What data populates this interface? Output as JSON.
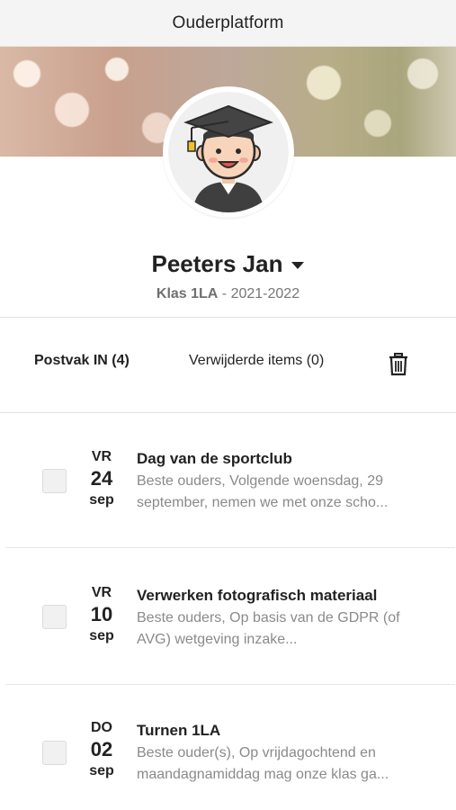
{
  "app": {
    "title": "Ouderplatform"
  },
  "profile": {
    "name": "Peeters Jan",
    "class_label": "Klas 1LA",
    "class_sep": " - ",
    "year": "2021-2022"
  },
  "tabs": {
    "inbox": "Postvak IN (4)",
    "deleted": "Verwijderde items (0)"
  },
  "messages": [
    {
      "day": "VR",
      "num": "24",
      "month": "sep",
      "title": "Dag van de sportclub",
      "preview": "Beste ouders,   Volgende woensdag, 29 september, nemen we met onze scho..."
    },
    {
      "day": "VR",
      "num": "10",
      "month": "sep",
      "title": "Verwerken fotografisch materiaal",
      "preview": "Beste ouders, Op basis van de GDPR (of AVG) wetgeving inzake..."
    },
    {
      "day": "DO",
      "num": "02",
      "month": "sep",
      "title": "Turnen 1LA",
      "preview": "Beste ouder(s), Op vrijdagochtend en maandagnamiddag mag onze klas ga..."
    }
  ],
  "icons": {
    "avatar": "graduate-avatar-icon",
    "dropdown": "caret-down-icon",
    "trash": "trash-icon"
  },
  "colors": {
    "topbar": "#f4f4f4",
    "preview_text": "#8a8a8a"
  }
}
